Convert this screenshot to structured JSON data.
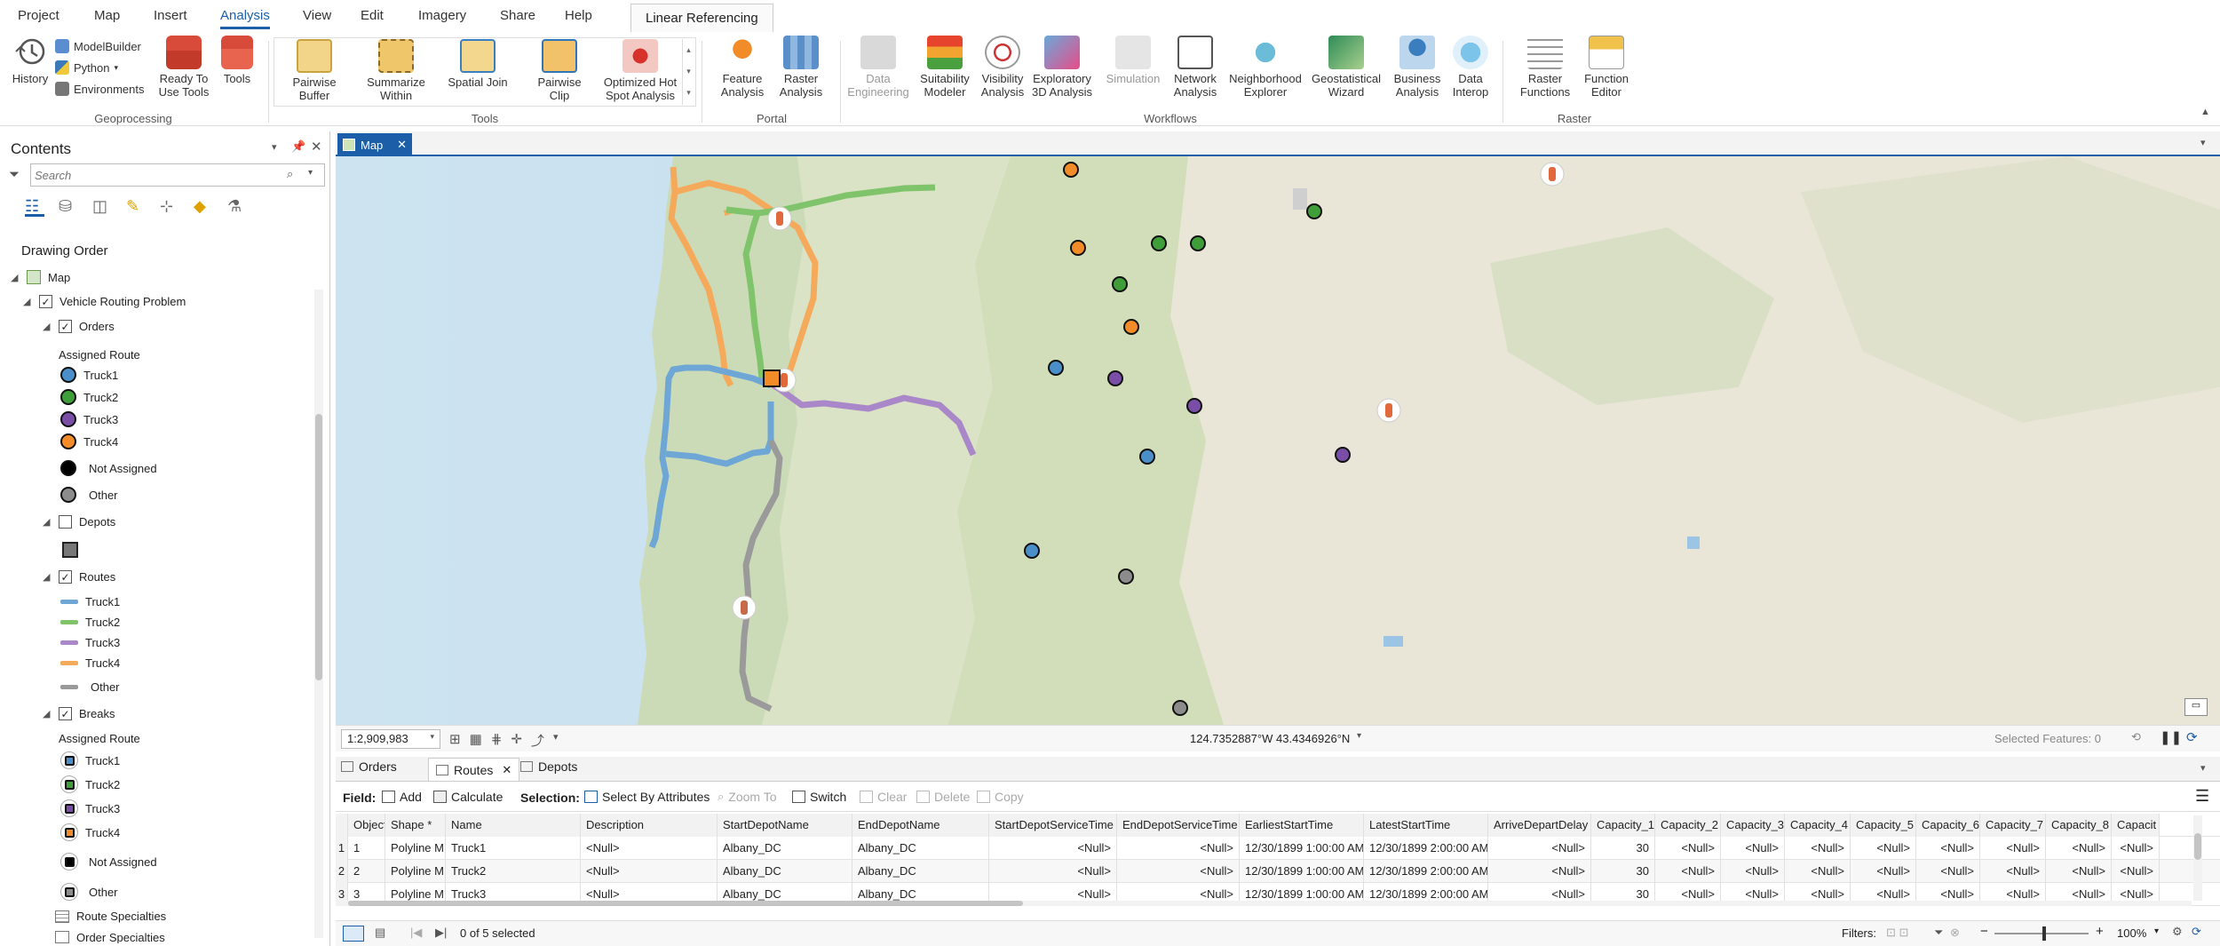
{
  "menu": {
    "items": [
      "Project",
      "Map",
      "Insert",
      "Analysis",
      "View",
      "Edit",
      "Imagery",
      "Share",
      "Help"
    ],
    "active": "Analysis",
    "contextual_tab": "Linear Referencing"
  },
  "ribbon": {
    "geoprocessing": {
      "label": "Geoprocessing",
      "history": "History",
      "modelbuilder": "ModelBuilder",
      "python": "Python",
      "environments": "Environments",
      "ready_to_use": "Ready To Use Tools",
      "tools": "Tools"
    },
    "tools": {
      "label": "Tools",
      "items": [
        "Pairwise Buffer",
        "Summarize Within",
        "Spatial Join",
        "Pairwise Clip",
        "Optimized Hot Spot Analysis"
      ]
    },
    "portal": {
      "label": "Portal",
      "items": [
        "Feature Analysis",
        "Raster Analysis"
      ]
    },
    "workflows": {
      "label": "Workflows",
      "items": [
        "Data Engineering",
        "Suitability Modeler",
        "Visibility Analysis",
        "Exploratory 3D Analysis",
        "Simulation",
        "Network Analysis",
        "Neighborhood Explorer",
        "Geostatistical Wizard",
        "Business Analysis",
        "Data Interop"
      ]
    },
    "raster": {
      "label": "Raster",
      "items": [
        "Raster Functions",
        "Function Editor"
      ]
    }
  },
  "contents": {
    "title": "Contents",
    "search_placeholder": "Search",
    "drawing_order": "Drawing Order",
    "map": "Map",
    "vrp": "Vehicle Routing Problem",
    "orders": {
      "name": "Orders",
      "heading": "Assigned Route",
      "classes": [
        "Truck1",
        "Truck2",
        "Truck3",
        "Truck4",
        "Not Assigned",
        "Other"
      ]
    },
    "depots": {
      "name": "Depots"
    },
    "routes": {
      "name": "Routes",
      "classes": [
        "Truck1",
        "Truck2",
        "Truck3",
        "Truck4",
        "Other"
      ]
    },
    "breaks": {
      "name": "Breaks",
      "heading": "Assigned Route",
      "classes": [
        "Truck1",
        "Truck2",
        "Truck3",
        "Truck4",
        "Not Assigned",
        "Other"
      ]
    },
    "route_specialties": "Route Specialties",
    "order_specialties": "Order Specialties"
  },
  "map": {
    "tab": "Map",
    "scale": "1:2,909,983",
    "coordinates": "124.7352887°W 43.4346926°N",
    "selected_features": "Selected Features: 0"
  },
  "colors": {
    "truck1": "#4a8fc9",
    "truck2": "#3f9e3a",
    "truck3": "#7a4ea6",
    "truck4": "#f28c28",
    "other": "#8c8c8c",
    "route1": "#6ea6d6",
    "route2": "#7fc46a",
    "route3": "#a987c9",
    "route4": "#f5a95b",
    "route_other": "#9a9a9a",
    "accent": "#1c5fa8"
  },
  "table": {
    "tabs": [
      "Orders",
      "Routes",
      "Depots"
    ],
    "active_tab": "Routes",
    "toolbar": {
      "field": "Field:",
      "add": "Add",
      "calculate": "Calculate",
      "selection": "Selection:",
      "select_by_attr": "Select By Attributes",
      "zoom_to": "Zoom To",
      "switch": "Switch",
      "clear": "Clear",
      "delete": "Delete",
      "copy": "Copy"
    },
    "columns": [
      "ObjectID *",
      "Shape *",
      "Name",
      "Description",
      "StartDepotName",
      "EndDepotName",
      "StartDepotServiceTime",
      "EndDepotServiceTime",
      "EarliestStartTime",
      "LatestStartTime",
      "ArriveDepartDelay",
      "Capacity_1",
      "Capacity_2",
      "Capacity_3",
      "Capacity_4",
      "Capacity_5",
      "Capacity_6",
      "Capacity_7",
      "Capacity_8",
      "Capacit"
    ],
    "rows": [
      [
        "1",
        "1",
        "Polyline M",
        "Truck1",
        "<Null>",
        "Albany_DC",
        "Albany_DC",
        "<Null>",
        "<Null>",
        "12/30/1899 1:00:00 AM",
        "12/30/1899 2:00:00 AM",
        "<Null>",
        "30",
        "<Null>",
        "<Null>",
        "<Null>",
        "<Null>",
        "<Null>",
        "<Null>",
        "<Null>",
        "<Null>"
      ],
      [
        "2",
        "2",
        "Polyline M",
        "Truck2",
        "<Null>",
        "Albany_DC",
        "Albany_DC",
        "<Null>",
        "<Null>",
        "12/30/1899 1:00:00 AM",
        "12/30/1899 2:00:00 AM",
        "<Null>",
        "30",
        "<Null>",
        "<Null>",
        "<Null>",
        "<Null>",
        "<Null>",
        "<Null>",
        "<Null>",
        "<Null>"
      ],
      [
        "3",
        "3",
        "Polyline M",
        "Truck3",
        "<Null>",
        "Albany_DC",
        "Albany_DC",
        "<Null>",
        "<Null>",
        "12/30/1899 1:00:00 AM",
        "12/30/1899 2:00:00 AM",
        "<Null>",
        "30",
        "<Null>",
        "<Null>",
        "<Null>",
        "<Null>",
        "<Null>",
        "<Null>",
        "<Null>",
        "<Null>"
      ]
    ],
    "selected_status": "0 of 5 selected",
    "filters": "Filters:",
    "zoom": "100%"
  }
}
